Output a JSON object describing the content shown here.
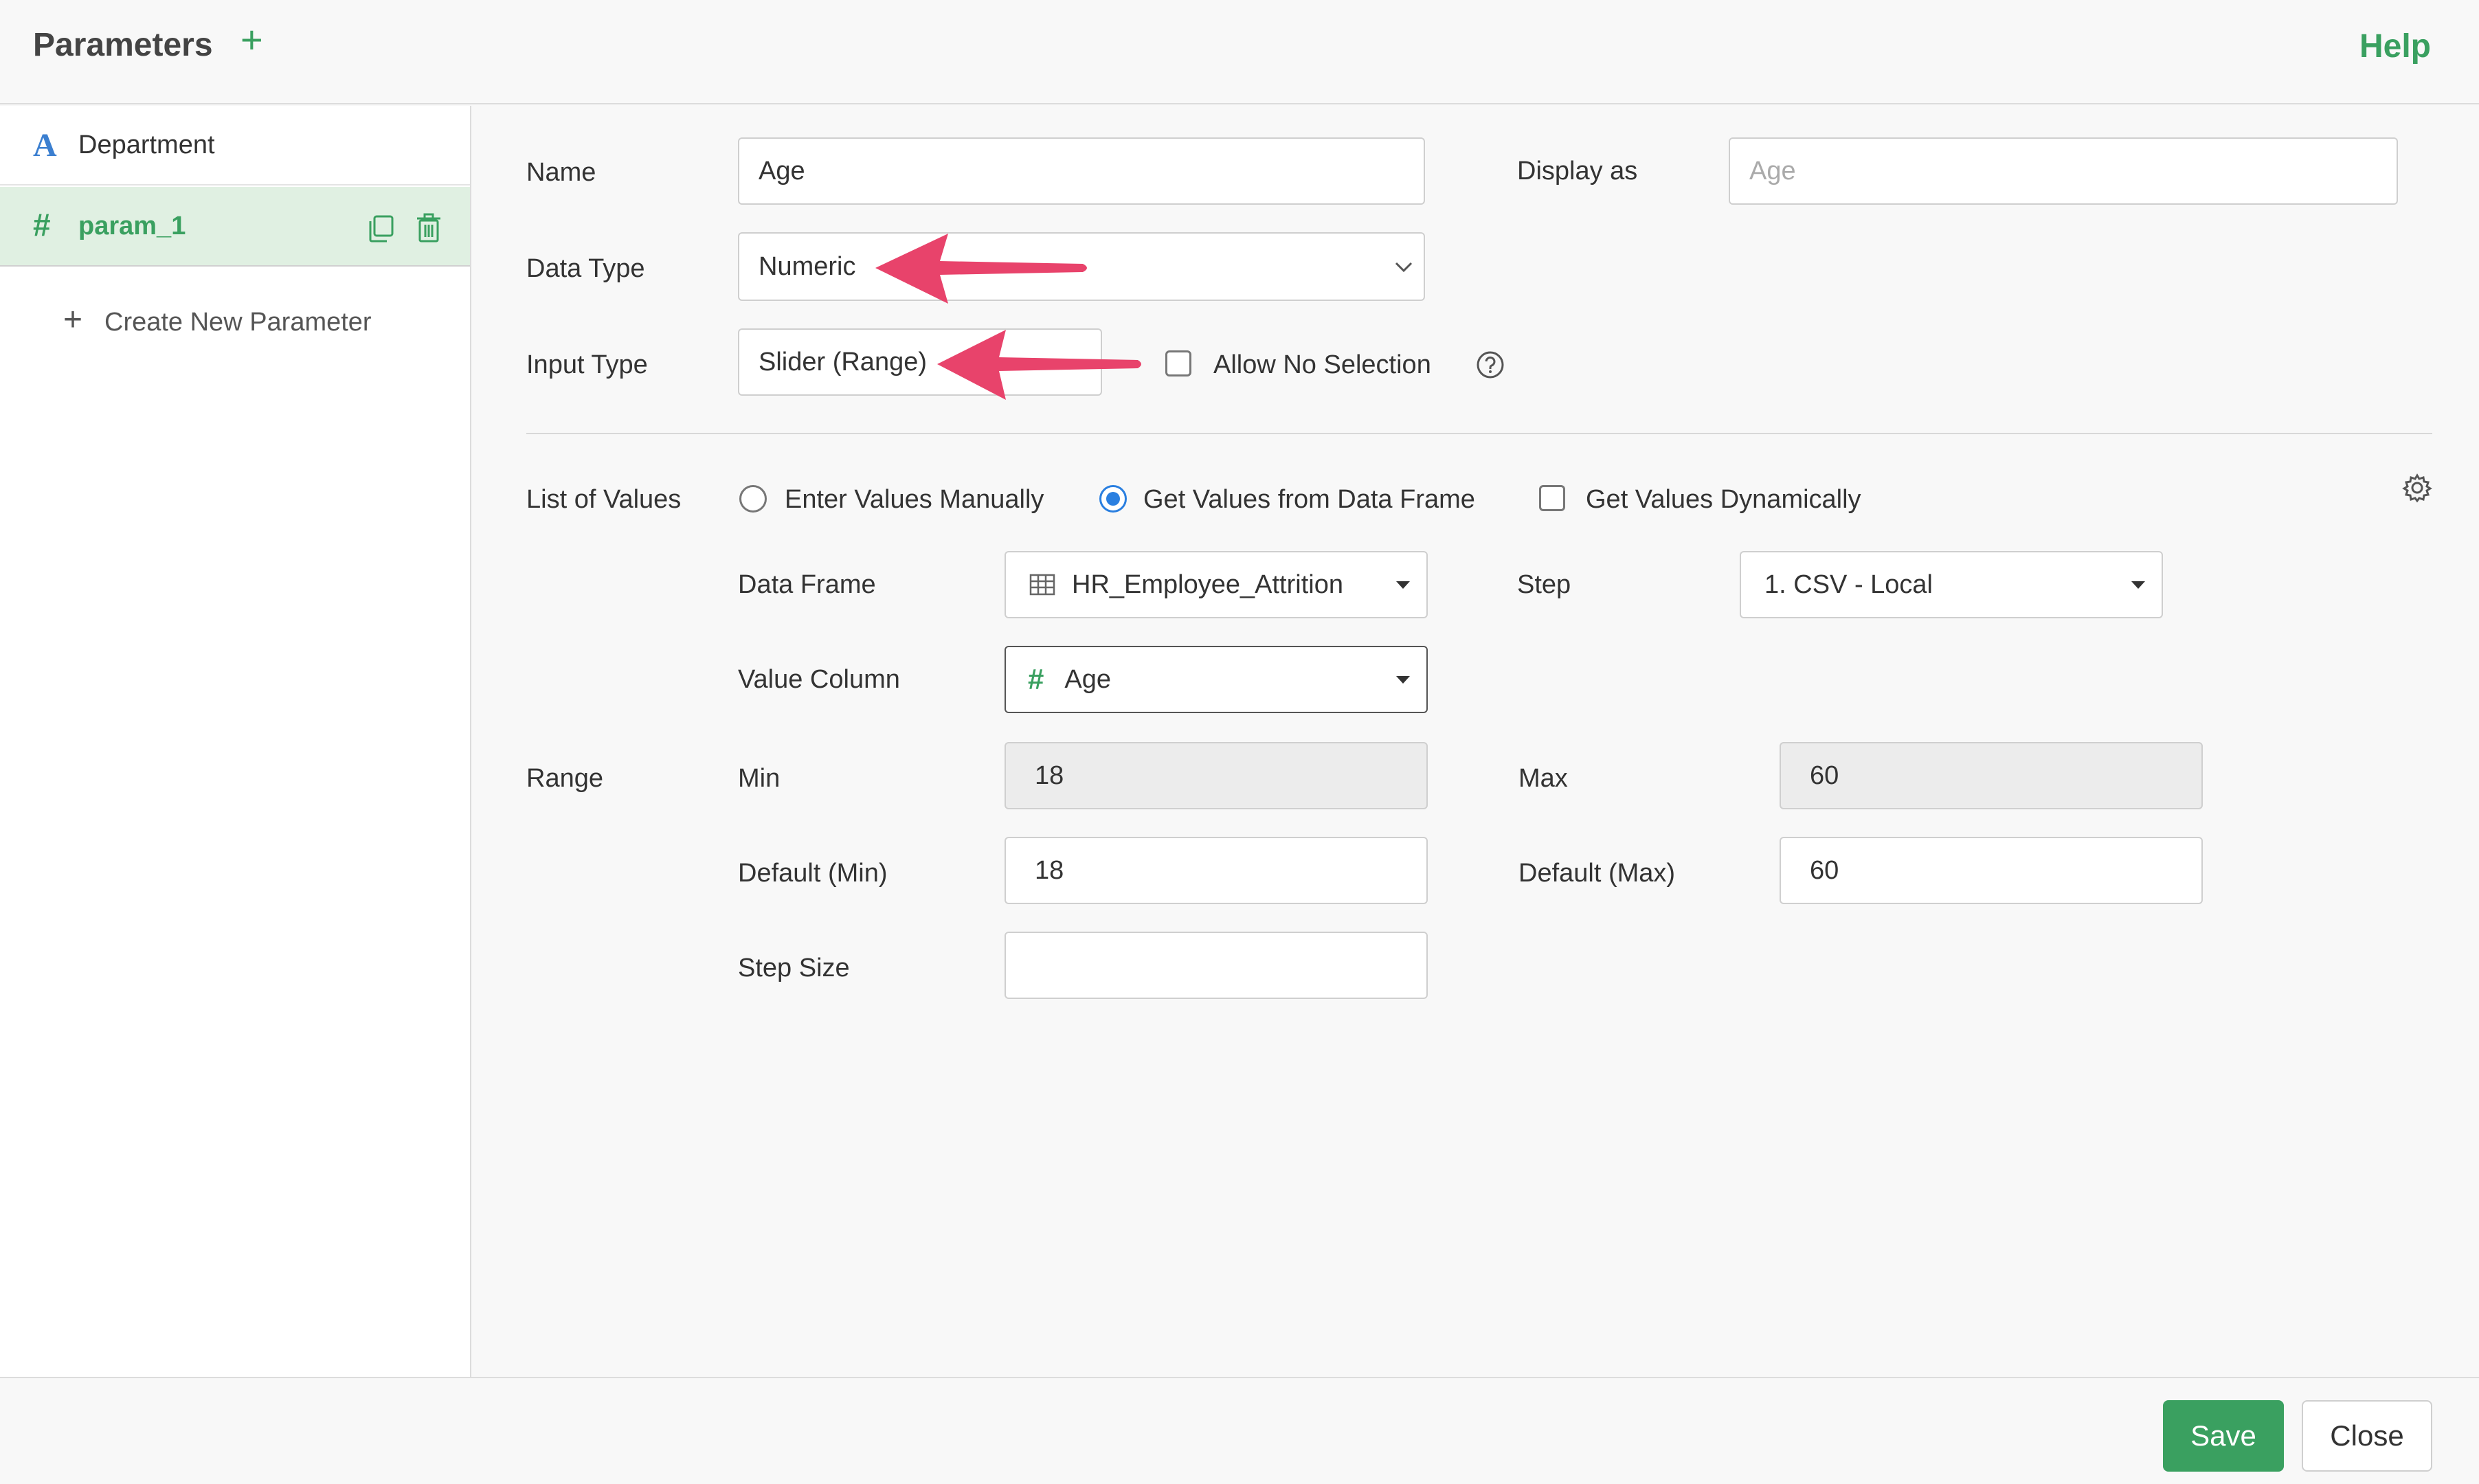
{
  "header": {
    "title": "Parameters",
    "add_icon": "plus-icon",
    "help_label": "Help"
  },
  "sidebar": {
    "items": [
      {
        "icon": "A",
        "icon_name": "text-type-icon",
        "label": "Department"
      },
      {
        "icon": "#",
        "icon_name": "numeric-type-icon",
        "label": "param_1",
        "selected": true
      }
    ],
    "create_plus": "+",
    "create_label": "Create New Parameter"
  },
  "form": {
    "name_label": "Name",
    "name_value": "Age",
    "display_as_label": "Display as",
    "display_as_placeholder": "Age",
    "data_type_label": "Data Type",
    "data_type_value": "Numeric",
    "input_type_label": "Input Type",
    "input_type_value": "Slider (Range)",
    "allow_no_selection_label": "Allow No Selection",
    "list_of_values_label": "List of Values",
    "options": {
      "manual": "Enter Values Manually",
      "data_frame": "Get Values from Data Frame",
      "dynamic": "Get Values Dynamically"
    },
    "data_frame_label": "Data Frame",
    "data_frame_value": "HR_Employee_Attrition",
    "step_label": "Step",
    "step_value": "1. CSV - Local",
    "value_column_label": "Value Column",
    "value_column_icon": "#",
    "value_column_value": "Age",
    "range_label": "Range",
    "min_label": "Min",
    "min_value": "18",
    "max_label": "Max",
    "max_value": "60",
    "default_min_label": "Default (Min)",
    "default_min_value": "18",
    "default_max_label": "Default (Max)",
    "default_max_value": "60",
    "step_size_label": "Step Size",
    "step_size_value": ""
  },
  "footer": {
    "save_label": "Save",
    "close_label": "Close"
  },
  "colors": {
    "accent": "#3aa060",
    "annotation_arrow": "#e8436b",
    "radio_selected": "#2a7fe0"
  }
}
